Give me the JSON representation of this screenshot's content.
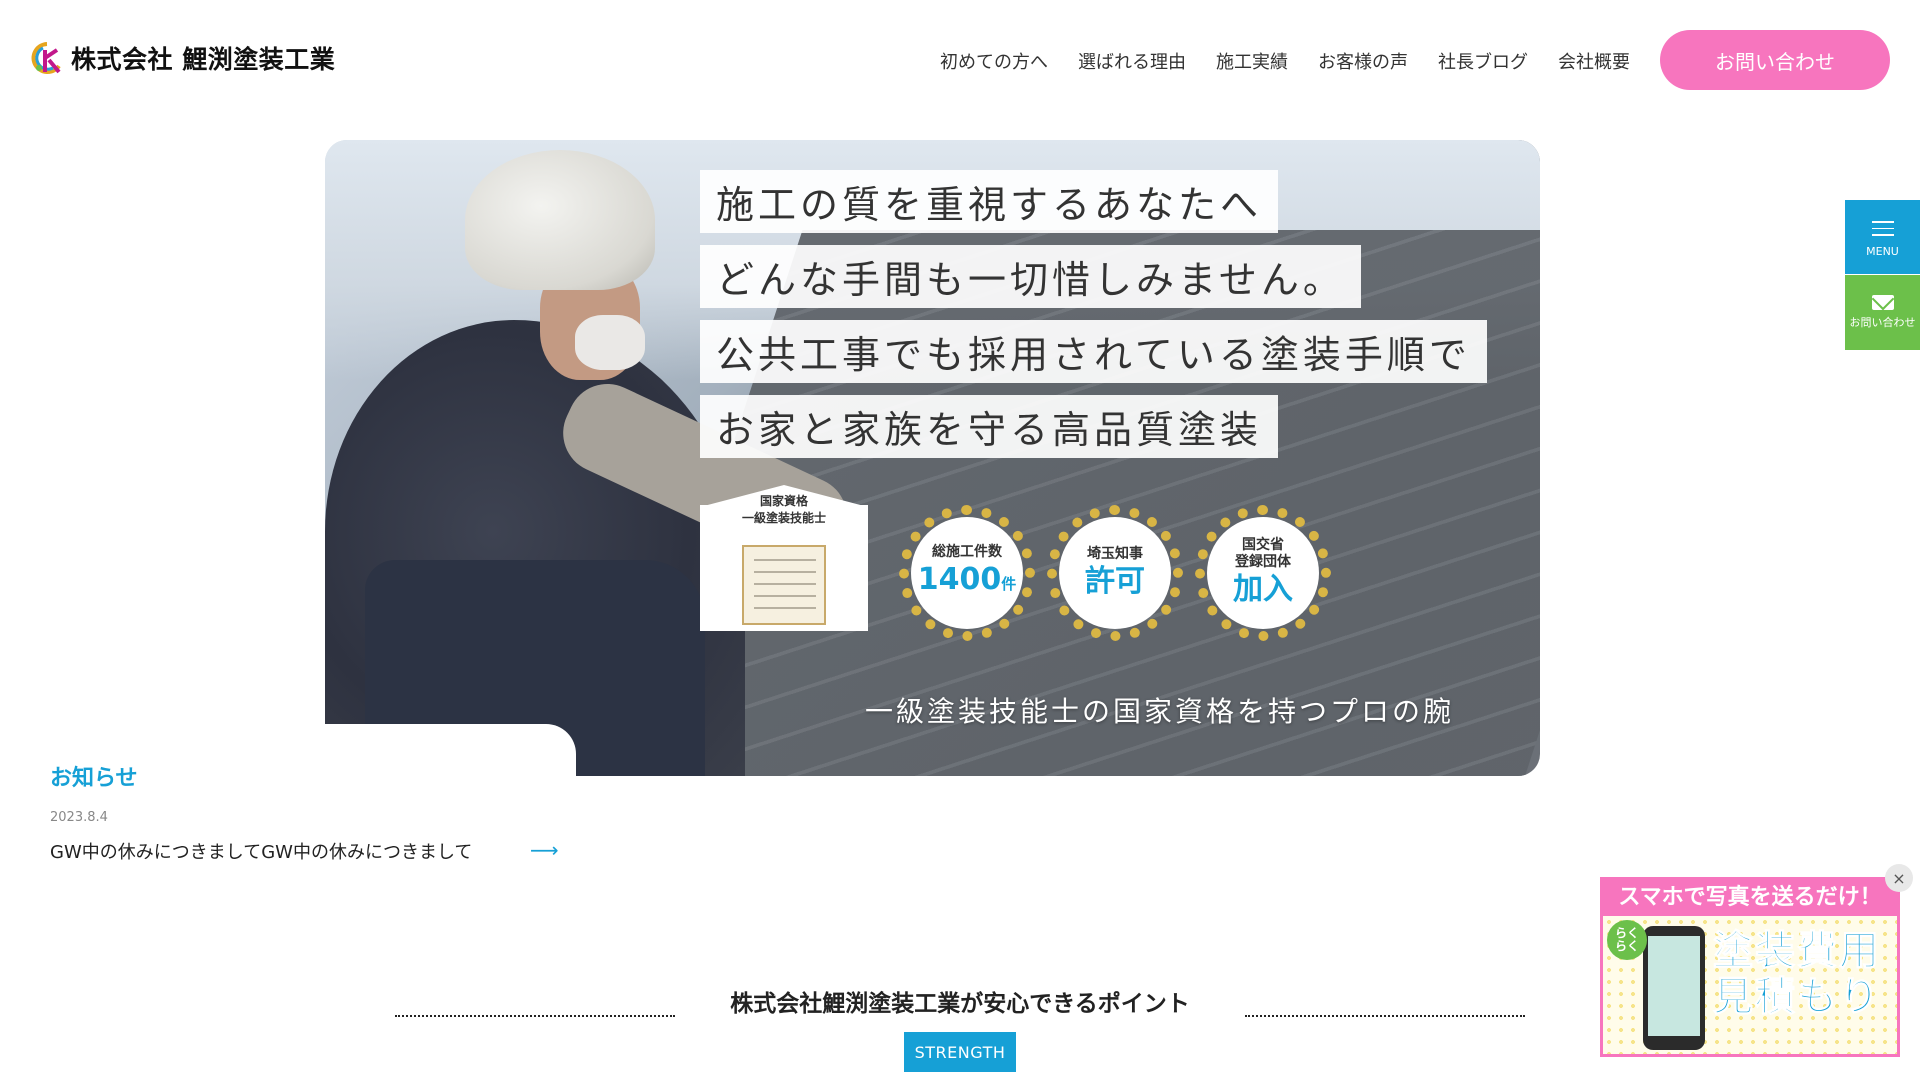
{
  "header": {
    "logo_text": "株式会社 鯉渕塗装工業",
    "nav": [
      {
        "label": "初めての方へ"
      },
      {
        "label": "選ばれる理由"
      },
      {
        "label": "施工実績"
      },
      {
        "label": "お客様の声"
      },
      {
        "label": "社長ブログ"
      },
      {
        "label": "会社概要"
      }
    ],
    "contact_label": "お問い合わせ"
  },
  "hero": {
    "catch": [
      "施工の質を重視するあなたへ",
      "どんな手間も一切惜しみません。",
      "公共工事でも採用されている塗装手順で",
      "お家と家族を守る高品質塗装"
    ],
    "cert": {
      "line1": "国家資格",
      "line2": "一級塗装技能士"
    },
    "badges": [
      {
        "label": "総施工件数",
        "value": "1400",
        "unit": "件"
      },
      {
        "label": "埼玉知事",
        "value": "許可",
        "unit": ""
      },
      {
        "label": "国交省\n登録団体",
        "value": "加入",
        "unit": ""
      }
    ],
    "caption": "一級塗装技能士の国家資格を持つプロの腕"
  },
  "news": {
    "title": "お知らせ",
    "date": "2023.8.4",
    "text": "GW中の休みにつきましてGW中の休みにつきまして",
    "arrow": "⟶"
  },
  "side": {
    "menu_label": "MENU",
    "contact_label": "お問い合わせ"
  },
  "banner": {
    "top": "スマホで写真を送るだけ！",
    "tag": "らく\nらく",
    "title_line1": "塗装費用",
    "title_line2": "見積もり",
    "close": "×"
  },
  "points": {
    "title": "株式会社鯉渕塗装工業が安心できるポイント",
    "tag": "STRENGTH"
  },
  "colors": {
    "accent": "#16a0d6",
    "pink": "#f775be",
    "green": "#6cc04a",
    "gold": "#d8b545"
  }
}
